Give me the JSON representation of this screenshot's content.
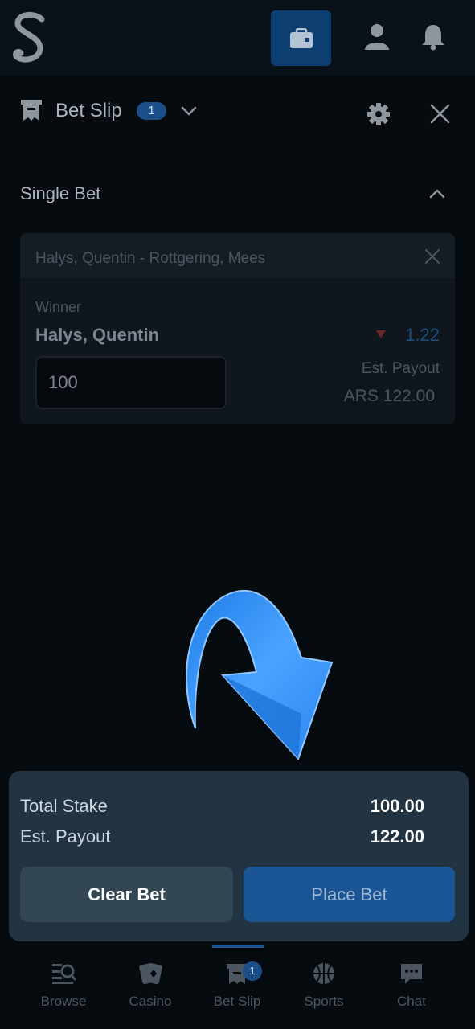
{
  "header": {
    "logo_letter": "S"
  },
  "betslip": {
    "title": "Bet Slip",
    "count": "1"
  },
  "single_bet": {
    "title": "Single Bet",
    "event": "Halys, Quentin - Rottgering, Mees",
    "market": "Winner",
    "selection": "Halys, Quentin",
    "odds": "1.22",
    "stake_value": "100",
    "est_payout_label": "Est. Payout",
    "est_payout_value": "ARS 122.00"
  },
  "summary": {
    "total_stake_label": "Total Stake",
    "total_stake_value": "100.00",
    "est_payout_label": "Est. Payout",
    "est_payout_value": "122.00",
    "clear_label": "Clear Bet",
    "place_label": "Place Bet"
  },
  "nav": {
    "items": [
      {
        "label": "Browse"
      },
      {
        "label": "Casino"
      },
      {
        "label": "Bet Slip",
        "badge": "1"
      },
      {
        "label": "Sports"
      },
      {
        "label": "Chat"
      }
    ]
  },
  "colors": {
    "background": "#060b10",
    "accent": "#1a5596",
    "panel": "#223441"
  }
}
